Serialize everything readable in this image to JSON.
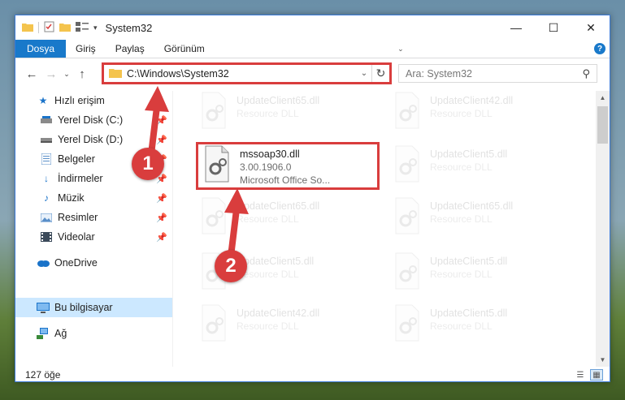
{
  "window": {
    "title": "System32"
  },
  "ribbon": {
    "tabs": [
      "Dosya",
      "Giriş",
      "Paylaş",
      "Görünüm"
    ]
  },
  "nav": {
    "address_path": "C:\\Windows\\System32",
    "search_placeholder": "Ara: System32"
  },
  "sidebar": {
    "items": [
      {
        "label": "Hızlı erişim",
        "icon": "star-icon"
      },
      {
        "label": "Yerel Disk (C:)",
        "icon": "drive-icon",
        "pinned": true
      },
      {
        "label": "Yerel Disk (D:)",
        "icon": "drive-icon",
        "pinned": true
      },
      {
        "label": "Belgeler",
        "icon": "documents-icon",
        "pinned": true
      },
      {
        "label": "İndirmeler",
        "icon": "download-icon",
        "pinned": true
      },
      {
        "label": "Müzik",
        "icon": "music-icon",
        "pinned": true
      },
      {
        "label": "Resimler",
        "icon": "pictures-icon",
        "pinned": true
      },
      {
        "label": "Videolar",
        "icon": "videos-icon",
        "pinned": true
      },
      {
        "label": "OneDrive",
        "icon": "cloud-icon"
      },
      {
        "label": "Bu bilgisayar",
        "icon": "computer-icon",
        "selected": true
      },
      {
        "label": "Ağ",
        "icon": "network-icon"
      }
    ]
  },
  "files": {
    "highlighted": {
      "name": "mssoap30.dll",
      "version": "3.00.1906.0",
      "description": "Microsoft Office So..."
    },
    "faded": [
      {
        "name": "UpdateClient65.dll",
        "type": "Resource DLL"
      },
      {
        "name": "UpdateClient42.dll",
        "type": "Resource DLL"
      },
      {
        "name": "UpdateClient5.dll",
        "type": "Resource DLL"
      },
      {
        "name": "UpdateClient65.dll",
        "type": "Resource DLL"
      },
      {
        "name": "UpdateClient65.dll",
        "type": "Resource DLL"
      },
      {
        "name": "UpdateClient5.dll",
        "type": "Resource DLL"
      },
      {
        "name": "UpdateClient5.dll",
        "type": "Resource DLL"
      },
      {
        "name": "UpdateClient42.dll",
        "type": "Resource DLL"
      },
      {
        "name": "UpdateClient5.dll",
        "type": "Resource DLL"
      }
    ]
  },
  "status": {
    "item_count": "127 öğe"
  },
  "annotations": {
    "step1": "1",
    "step2": "2"
  },
  "colors": {
    "accent": "#1979ca",
    "highlight_red": "#d93d3d",
    "selected_bg": "#cce8ff"
  }
}
